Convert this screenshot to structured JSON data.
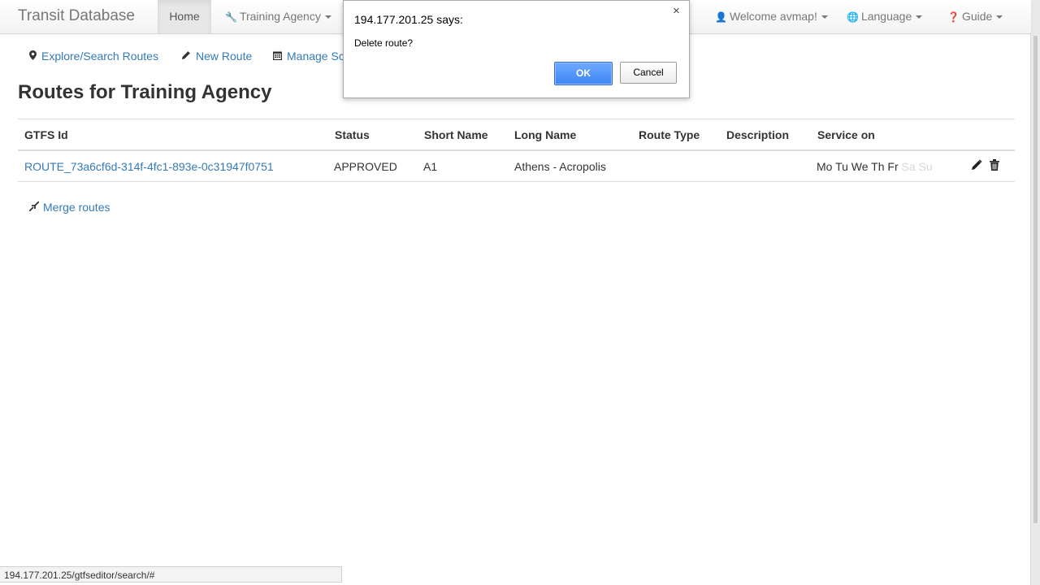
{
  "navbar": {
    "brand": "Transit Database",
    "home": "Home",
    "agency": "Training Agency",
    "user": "Welcome avmap!",
    "language": "Language",
    "guide": "Guide"
  },
  "actions": {
    "explore": "Explore/Search Routes",
    "new_route": "New Route",
    "manage": "Manage Sc"
  },
  "page_title": "Routes for Training Agency",
  "table": {
    "headers": [
      "GTFS Id",
      "Status",
      "Short Name",
      "Long Name",
      "Route Type",
      "Description",
      "Service on"
    ],
    "rows": [
      {
        "gtfs_id": "ROUTE_73a6cf6d-314f-4fc1-893e-0c31947f0751",
        "status": "APPROVED",
        "short_name": "A1",
        "long_name": "Athens - Acropolis",
        "route_type": "",
        "description": "",
        "service_on": "Mo Tu We Th Fr",
        "service_off": "Sa Su"
      }
    ]
  },
  "merge_routes": "Merge routes",
  "dialog": {
    "title": "194.177.201.25 says:",
    "message": "Delete route?",
    "ok": "OK",
    "cancel": "Cancel",
    "close": "×"
  },
  "statusbar": "194.177.201.25/gtfseditor/search/#",
  "icons": {
    "wrench": "wrench-icon",
    "user": "user-icon",
    "globe": "globe-icon",
    "question": "question-icon",
    "map_marker": "map-marker-icon",
    "pencil": "pencil-icon",
    "calendar": "calendar-icon",
    "trash": "trash-icon",
    "merge": "merge-icon"
  },
  "colors": {
    "link": "#337ab7",
    "ok_button": "#4a8ff7"
  }
}
